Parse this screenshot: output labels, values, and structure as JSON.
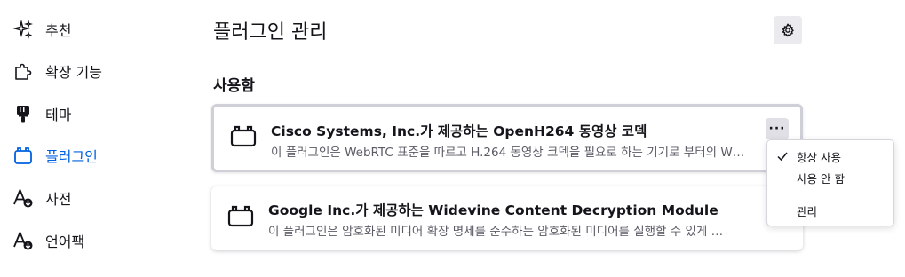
{
  "sidebar": {
    "items": [
      {
        "label": "추천",
        "icon": "sparkle-icon",
        "active": false
      },
      {
        "label": "확장 기능",
        "icon": "puzzle-icon",
        "active": false
      },
      {
        "label": "테마",
        "icon": "brush-icon",
        "active": false
      },
      {
        "label": "플러그인",
        "icon": "plugin-icon",
        "active": true
      },
      {
        "label": "사전",
        "icon": "dictionary-icon",
        "active": false
      },
      {
        "label": "언어팩",
        "icon": "language-icon",
        "active": false
      }
    ]
  },
  "header": {
    "title": "플러그인 관리",
    "settings_icon": "gear-icon"
  },
  "section": {
    "title": "사용함"
  },
  "plugins": [
    {
      "name": "Cisco Systems, Inc.가 제공하는 OpenH264 동영상 코덱",
      "description": "이 플러그인은 WebRTC 표준을 따르고 H.264 동영상 코덱을 필요로 하는 기기로 부터의 W…",
      "icon": "plugin-icon"
    },
    {
      "name": "Google Inc.가 제공하는 Widevine Content Decryption Module",
      "description": "이 플러그인은 암호화된 미디어 확장 명세를 준수하는 암호화된 미디어를 실행할 수 있게 …",
      "icon": "plugin-icon"
    }
  ],
  "more_button": {
    "label": "···",
    "icon": "more-icon"
  },
  "menu": {
    "items": [
      {
        "label": "항상 사용",
        "checked": true
      },
      {
        "label": "사용 안 함",
        "checked": false
      }
    ],
    "manage_label": "관리"
  },
  "colors": {
    "accent": "#0061e0",
    "text": "#15141a",
    "secondary_text": "#5b5b66"
  }
}
